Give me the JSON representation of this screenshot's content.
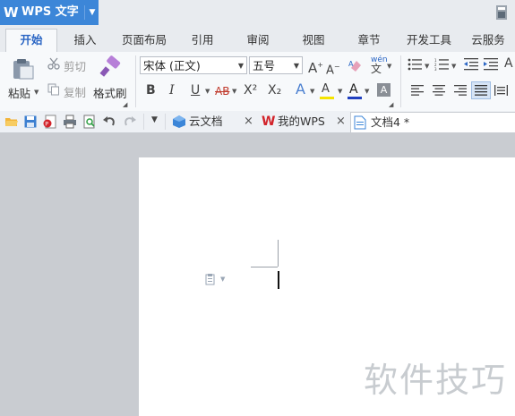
{
  "app": {
    "title": "WPS 文字"
  },
  "tabs": [
    "开始",
    "插入",
    "页面布局",
    "引用",
    "审阅",
    "视图",
    "章节",
    "开发工具",
    "云服务"
  ],
  "clipboard": {
    "paste": "粘贴",
    "cut": "剪切",
    "copy": "复制",
    "format_painter": "格式刷"
  },
  "font": {
    "name": "宋体 (正文)",
    "size": "五号"
  },
  "font_buttons": {
    "bold": "B",
    "italic": "I",
    "underline": "U",
    "strike": "AB",
    "superscript": "X²",
    "subscript": "X₂",
    "font_color": "A",
    "highlight": "A"
  },
  "doc_tabs": [
    {
      "label": "云文档"
    },
    {
      "label": "我的WPS"
    },
    {
      "label": "文档4 *"
    }
  ],
  "close_glyph": "×",
  "watermark": "软件技巧",
  "colors": {
    "accent": "#3c86d8",
    "font_color_bar": "#1f3fbf",
    "highlight_bar": "#f5e400",
    "wps_red": "#d2232a"
  }
}
